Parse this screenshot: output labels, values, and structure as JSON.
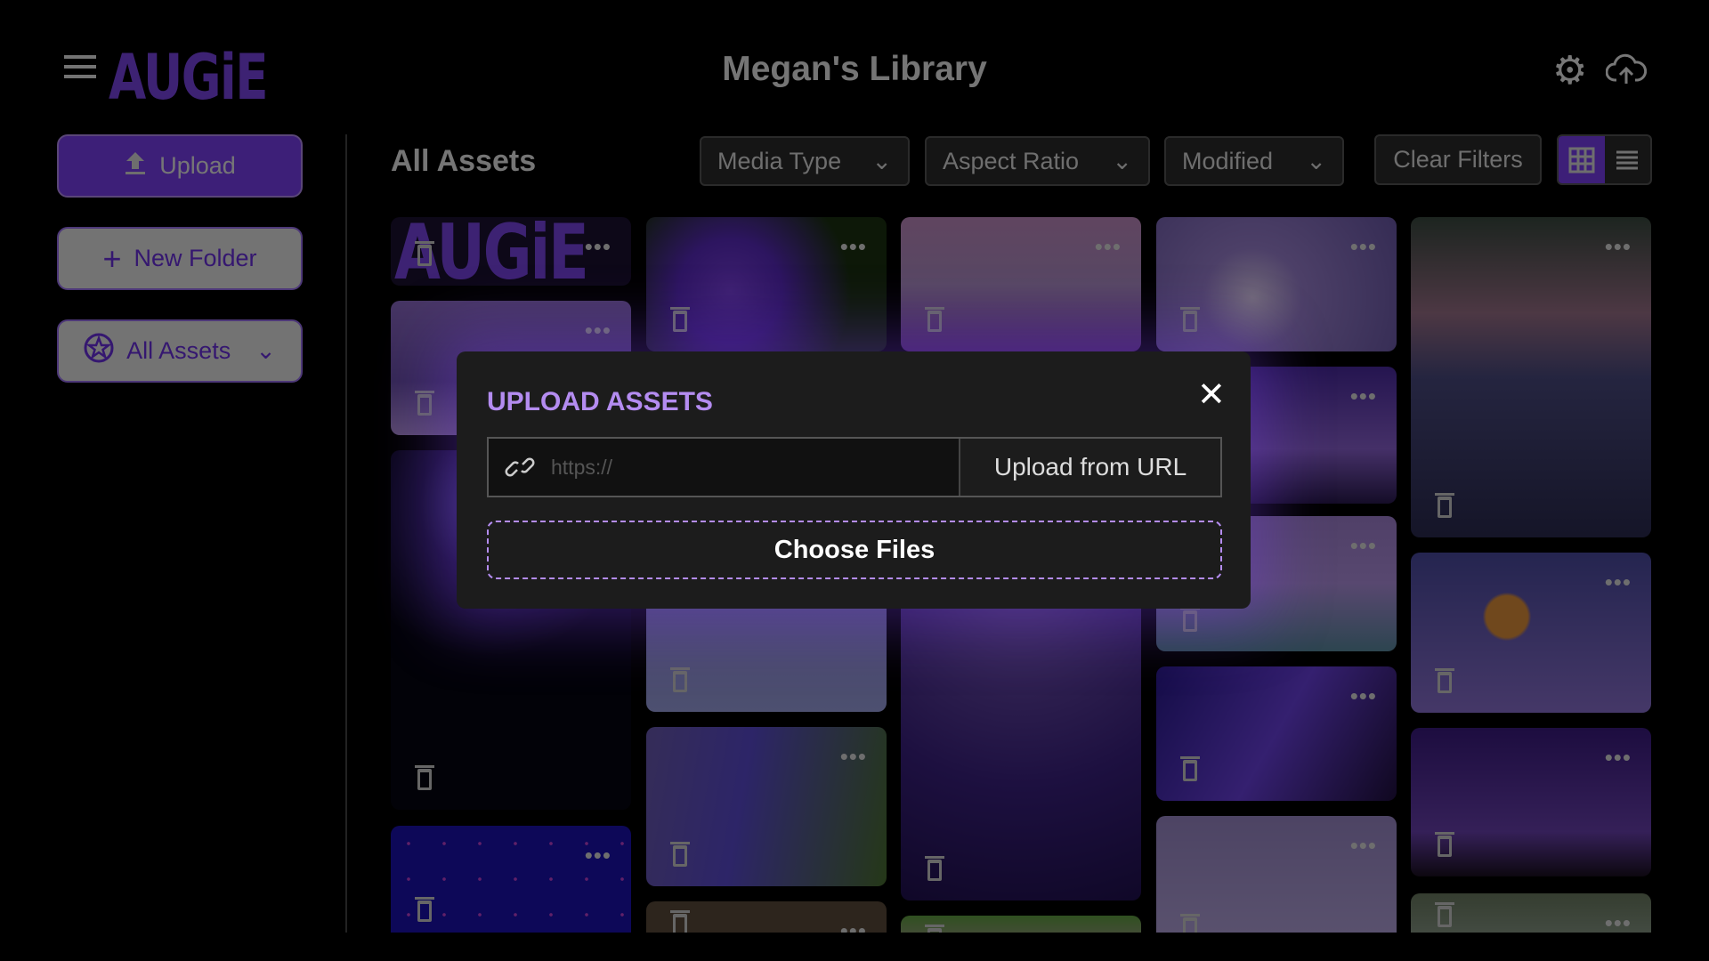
{
  "header": {
    "logo": "AUGiE",
    "title": "Megan's Library"
  },
  "sidebar": {
    "upload_label": "Upload",
    "new_folder_label": "New Folder",
    "folder_select_label": "All Assets"
  },
  "main": {
    "heading": "All Assets",
    "filters": [
      {
        "label": "Media Type"
      },
      {
        "label": "Aspect Ratio"
      },
      {
        "label": "Modified"
      }
    ],
    "clear_filters_label": "Clear Filters",
    "view_mode": "grid"
  },
  "modal": {
    "title": "UPLOAD ASSETS",
    "url_placeholder": "https://",
    "url_value": "",
    "upload_url_label": "Upload from URL",
    "choose_files_label": "Choose Files"
  },
  "colors": {
    "accent": "#7b3ff0",
    "accent_light": "#b48cf0",
    "background": "#000000",
    "modal_bg": "#1c1c1c"
  }
}
